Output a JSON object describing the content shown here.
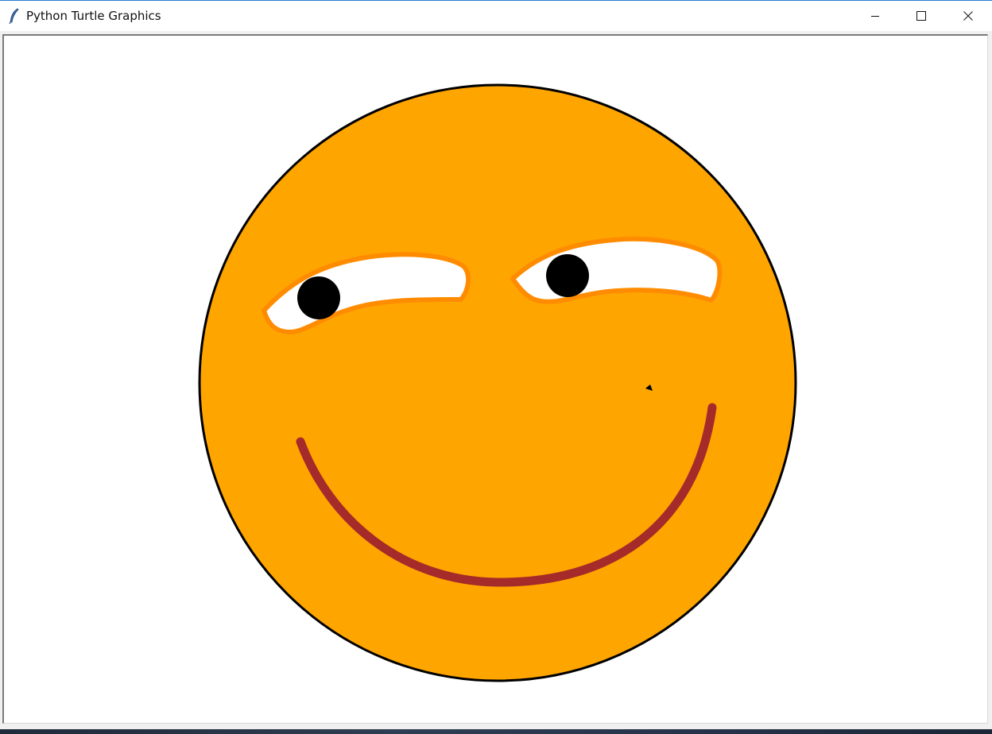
{
  "window": {
    "title": "Python Turtle Graphics",
    "icons": {
      "app": "feather-icon",
      "minimize": "minimize-icon",
      "maximize": "maximize-icon",
      "close": "close-icon"
    }
  },
  "drawing": {
    "colors": {
      "face_fill": "#ffa500",
      "face_outline": "#000000",
      "eye_white": "#ffffff",
      "eye_outline": "#ff8c00",
      "pupil": "#000000",
      "mouth": "#a52a2a",
      "turtle_cursor": "#000000"
    }
  }
}
